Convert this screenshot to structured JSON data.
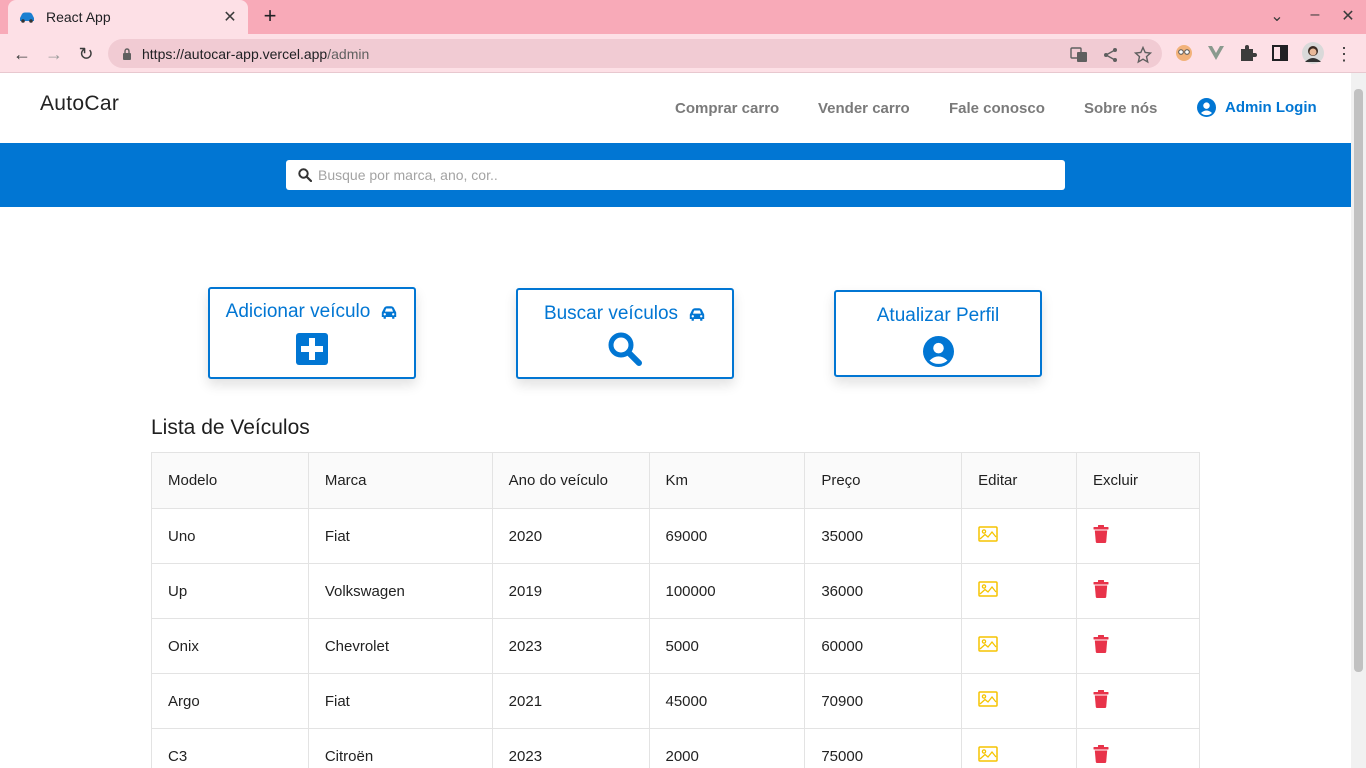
{
  "browser": {
    "tab_title": "React App",
    "url_host": "https://autocar-app.vercel.app",
    "url_path": "/admin",
    "close_glyph": "✕",
    "newtab_glyph": "+",
    "minimize_glyph": "–",
    "maximize_glyph": "☐",
    "winclose_glyph": "✕",
    "tabsearch_glyph": "⌄",
    "back_glyph": "←",
    "forward_glyph": "→",
    "reload_glyph": "↻",
    "menu_glyph": "⋮"
  },
  "header": {
    "brand": "AutoCar",
    "nav": {
      "buy": "Comprar carro",
      "sell": "Vender carro",
      "contact": "Fale conosco",
      "about": "Sobre nós"
    },
    "admin_login": "Admin Login"
  },
  "search": {
    "placeholder": "Busque por marca, ano, cor.."
  },
  "cards": {
    "add": "Adicionar veículo",
    "find": "Buscar veículos",
    "profile": "Atualizar Perfil"
  },
  "list": {
    "title": "Lista de Veículos",
    "columns": [
      "Modelo",
      "Marca",
      "Ano do veículo",
      "Km",
      "Preço",
      "Editar",
      "Excluir"
    ],
    "rows": [
      {
        "modelo": "Uno",
        "marca": "Fiat",
        "ano": "2020",
        "km": "69000",
        "preco": "35000"
      },
      {
        "modelo": "Up",
        "marca": "Volkswagen",
        "ano": "2019",
        "km": "100000",
        "preco": "36000"
      },
      {
        "modelo": "Onix",
        "marca": "Chevrolet",
        "ano": "2023",
        "km": "5000",
        "preco": "60000"
      },
      {
        "modelo": "Argo",
        "marca": "Fiat",
        "ano": "2021",
        "km": "45000",
        "preco": "70900"
      },
      {
        "modelo": "C3",
        "marca": "Citroën",
        "ano": "2023",
        "km": "2000",
        "preco": "75000"
      }
    ]
  },
  "colors": {
    "primary": "#0176d3",
    "tabstrip": "#f8aab8",
    "edit_icon": "#f5c400",
    "delete_icon": "#e8334a"
  },
  "icons": {
    "edit": "image-icon",
    "delete": "trash-icon",
    "car": "car-icon",
    "add": "plus-square-icon",
    "search": "search-icon",
    "user": "user-circle-icon"
  }
}
